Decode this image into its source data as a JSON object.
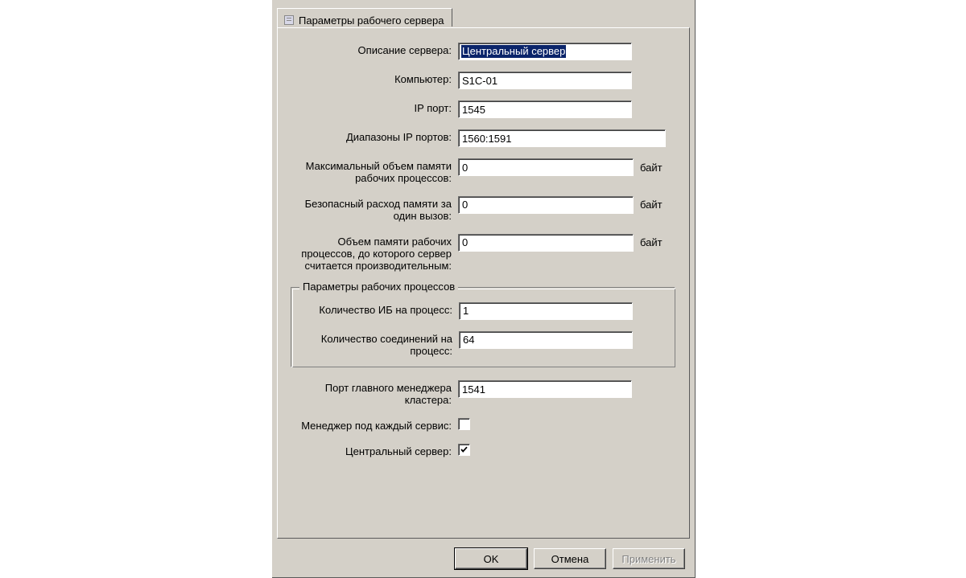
{
  "tab": {
    "title": "Параметры рабочего сервера"
  },
  "labels": {
    "description": "Описание сервера:",
    "computer": "Компьютер:",
    "ip_port": "IP порт:",
    "port_ranges": "Диапазоны IP портов:",
    "max_mem": "Максимальный объем памяти рабочих процессов:",
    "safe_mem": "Безопасный расход памяти за один вызов:",
    "perf_mem": "Объем памяти рабочих процессов, до которого сервер считается производительным:",
    "group_title": "Параметры рабочих процессов",
    "ib_per_proc": "Количество ИБ на процесс:",
    "conn_per_proc": "Количество соединений на процесс:",
    "main_mgr_port": "Порт главного менеджера кластера:",
    "mgr_per_service": "Менеджер под каждый сервис:",
    "central_server": "Центральный сервер:",
    "unit_bytes": "байт"
  },
  "values": {
    "description": "Центральный сервер",
    "computer": "S1C-01",
    "ip_port": "1545",
    "port_ranges": "1560:1591",
    "max_mem": "0",
    "safe_mem": "0",
    "perf_mem": "0",
    "ib_per_proc": "1",
    "conn_per_proc": "64",
    "main_mgr_port": "1541",
    "mgr_per_service_checked": false,
    "central_server_checked": true
  },
  "buttons": {
    "ok": "OK",
    "cancel": "Отмена",
    "apply": "Применить"
  }
}
